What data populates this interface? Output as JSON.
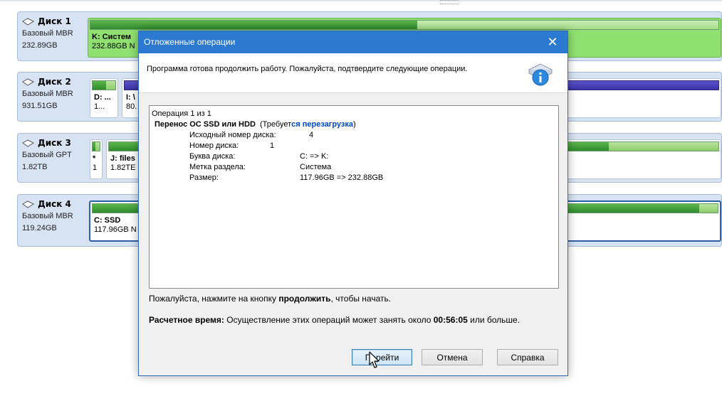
{
  "disks": [
    {
      "title": "Диск 1",
      "type": "Базовый MBR",
      "size": "232.89GB",
      "partitions": [
        {
          "name": "K: Систем",
          "size": "232.88GB N"
        }
      ]
    },
    {
      "title": "Диск 2",
      "type": "Базовый MBR",
      "size": "931.51GB",
      "partitions": [
        {
          "name": "D: ...",
          "size": "1..."
        },
        {
          "name": "I: \\",
          "size": "80."
        }
      ]
    },
    {
      "title": "Диск 3",
      "type": "Базовый GPT",
      "size": "1.82TB",
      "partitions": [
        {
          "name": "*",
          "size": "1"
        },
        {
          "name": "J: files",
          "size": "1.82TE"
        }
      ]
    },
    {
      "title": "Диск 4",
      "type": "Базовый MBR",
      "size": "119.24GB",
      "partitions": [
        {
          "name": "C: SSD",
          "size": "117.96GB N"
        }
      ]
    }
  ],
  "dialog": {
    "title": "Отложенные операции",
    "close_glyph": "✕",
    "message": "Программа готова продолжить работу. Пожалуйста, подтвердите следующие операции.",
    "operation_counter": "Операция 1 из 1",
    "operation_name": "Перенос ОС SSD или HDD",
    "operation_note_prefix": "(Требует",
    "operation_note_highlight": "ся перезагрузка",
    "operation_note_suffix": ")",
    "details": [
      {
        "key": "Исходный номер диска:",
        "value": "4"
      },
      {
        "key": "Номер диска:",
        "value": "1"
      },
      {
        "key": "Буква диска:",
        "value": "C: => K:"
      },
      {
        "key": "Метка раздела:",
        "value": "Система"
      },
      {
        "key": "Размер:",
        "value": "117.96GB => 232.88GB"
      }
    ],
    "hint_prefix": "Пожалуйста, нажмите на кнопку ",
    "hint_bold": "продолжить",
    "hint_suffix": ", чтобы начать.",
    "estimate_label": "Расчетное время:",
    "estimate_text": " Осуществление этих операций может занять около ",
    "estimate_time": "00:56:05",
    "estimate_suffix": " или больше.",
    "buttons": {
      "go": "Перейти",
      "cancel": "Отмена",
      "help": "Справка"
    }
  },
  "colors": {
    "titlebar": "#2b79d0",
    "partition_green": "#2e8b2e",
    "partition_blue": "#3a33a8",
    "warn_blue": "#0047c8"
  },
  "icons": {
    "disk": "disk-icon",
    "info": "info-icon",
    "close": "close-icon",
    "cursor": "mouse-cursor-icon"
  }
}
